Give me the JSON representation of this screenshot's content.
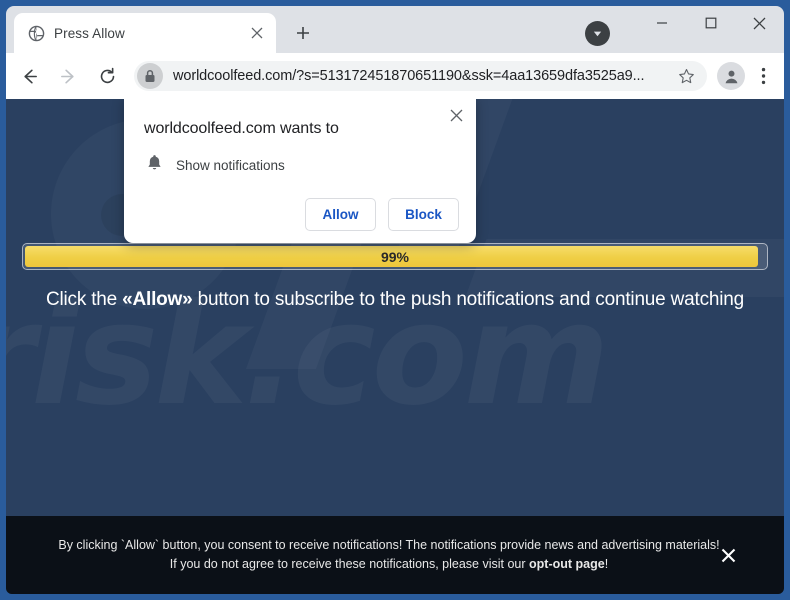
{
  "browser": {
    "tab": {
      "title": "Press Allow",
      "favicon": "globe-icon",
      "close_icon": "close-icon"
    },
    "new_tab_icon": "plus-icon",
    "tab_search_icon": "chevron-down-icon",
    "window_controls": {
      "minimize": "minimize-icon",
      "maximize": "maximize-icon",
      "close": "close-icon"
    },
    "toolbar": {
      "back_icon": "arrow-left-icon",
      "forward_icon": "arrow-right-icon",
      "reload_icon": "reload-icon",
      "site_info_icon": "lock-icon",
      "url": "worldcoolfeed.com/?s=513172451870651190&ssk=4aa13659dfa3525a9...",
      "bookmark_icon": "star-icon",
      "profile_icon": "person-icon",
      "menu_icon": "three-dot-menu-icon"
    }
  },
  "permission_dialog": {
    "title": "worldcoolfeed.com wants to",
    "permission_icon": "bell-icon",
    "permission_label": "Show notifications",
    "allow_label": "Allow",
    "block_label": "Block",
    "close_icon": "close-icon"
  },
  "page": {
    "background_color": "#2a4060",
    "watermark_text": "risk.com",
    "progress": {
      "percent_label": "99%",
      "percent_value": 99,
      "fill_color": "#efcf45"
    },
    "headline": {
      "before": "Click the ",
      "emphasis": "«Allow»",
      "after": " button to subscribe to the push notifications and continue watching"
    }
  },
  "consent_banner": {
    "line1": "By clicking `Allow` button, you consent to receive notifications! The notifications provide news and advertising",
    "line2_before": "materials! If you do not agree to receive these notifications, please visit our ",
    "line2_link": "opt-out page",
    "line2_after": "!",
    "close_icon": "close-icon",
    "background_color": "#0b1017"
  }
}
